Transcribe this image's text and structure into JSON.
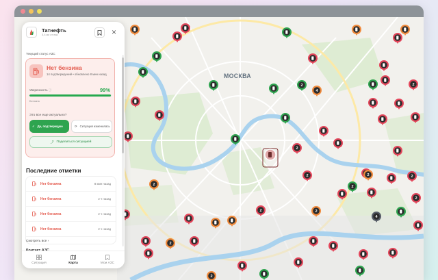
{
  "window": {
    "controls": [
      "close",
      "minimize",
      "maximize"
    ]
  },
  "map": {
    "city_label": "МОСКВА",
    "selected_marker_icon": "gas-station-icon"
  },
  "station": {
    "name": "Татнефть",
    "subtitle": "3,4 км от вас",
    "logo_icon": "tatneft-logo-icon",
    "actions": {
      "bookmark_icon": "bookmark-icon",
      "close_glyph": "✕"
    }
  },
  "status": {
    "section_label": "Текущий статус АЗС",
    "title": "Нет бензина",
    "subtitle": "14 подтверждений • обновлено 8 мин назад",
    "confidence_label": "Уверенность",
    "confidence_value": "99%",
    "confidence_fraction": 0.99,
    "note": "Бензина",
    "question": "Это все еще актуально?",
    "confirm_label": "Да, подтверждаю",
    "changed_label": "Ситуация изменилась",
    "share_label": "Поделиться ситуацией",
    "colors": {
      "alert": "#e45a4d",
      "ok": "#2ea44f"
    }
  },
  "recent": {
    "title": "Последние отметки",
    "items": [
      {
        "label": "Нет бензина",
        "time": "8 мин назад"
      },
      {
        "label": "Нет бензина",
        "time": "2 ч назад"
      },
      {
        "label": "Нет бензина",
        "time": "2 ч назад"
      },
      {
        "label": "Нет бензина",
        "time": "2 ч назад"
      }
    ],
    "see_all": "Смотреть все",
    "next_section_partial": "Контакт АЗС"
  },
  "nav": {
    "items": [
      {
        "label": "Ситуация",
        "icon": "grid-icon",
        "active": false
      },
      {
        "label": "Карта",
        "icon": "map-icon",
        "active": true
      },
      {
        "label": "Мои АЗС",
        "icon": "bookmark-icon",
        "active": false
      }
    ]
  }
}
